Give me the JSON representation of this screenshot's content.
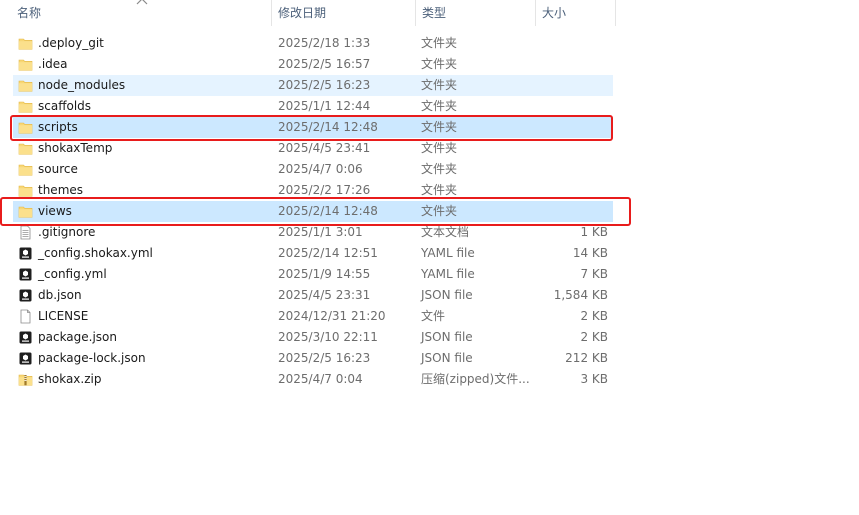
{
  "columns": {
    "name": "名称",
    "date": "修改日期",
    "type": "类型",
    "size": "大小"
  },
  "colors": {
    "selected_bg": "#cce8ff",
    "hover_bg": "#e5f3ff",
    "highlight_border": "#e81c1c",
    "header_text": "#4c607a"
  },
  "files": [
    {
      "name": ".deploy_git",
      "date": "2025/2/18 1:33",
      "type": "文件夹",
      "size": "",
      "icon": "folder-icon",
      "state": ""
    },
    {
      "name": ".idea",
      "date": "2025/2/5 16:57",
      "type": "文件夹",
      "size": "",
      "icon": "folder-icon",
      "state": ""
    },
    {
      "name": "node_modules",
      "date": "2025/2/5 16:23",
      "type": "文件夹",
      "size": "",
      "icon": "folder-icon",
      "state": "hover"
    },
    {
      "name": "scaffolds",
      "date": "2025/1/1 12:44",
      "type": "文件夹",
      "size": "",
      "icon": "folder-icon",
      "state": ""
    },
    {
      "name": "scripts",
      "date": "2025/2/14 12:48",
      "type": "文件夹",
      "size": "",
      "icon": "folder-icon",
      "state": "selected"
    },
    {
      "name": "shokaxTemp",
      "date": "2025/4/5 23:41",
      "type": "文件夹",
      "size": "",
      "icon": "folder-icon",
      "state": ""
    },
    {
      "name": "source",
      "date": "2025/4/7 0:06",
      "type": "文件夹",
      "size": "",
      "icon": "folder-icon",
      "state": ""
    },
    {
      "name": "themes",
      "date": "2025/2/2 17:26",
      "type": "文件夹",
      "size": "",
      "icon": "folder-icon",
      "state": ""
    },
    {
      "name": "views",
      "date": "2025/2/14 12:48",
      "type": "文件夹",
      "size": "",
      "icon": "folder-icon",
      "state": "selected"
    },
    {
      "name": ".gitignore",
      "date": "2025/1/1 3:01",
      "type": "文本文档",
      "size": "1 KB",
      "icon": "text-file-icon",
      "state": ""
    },
    {
      "name": "_config.shokax.yml",
      "date": "2025/2/14 12:51",
      "type": "YAML file",
      "size": "14 KB",
      "icon": "app-file-icon",
      "state": ""
    },
    {
      "name": "_config.yml",
      "date": "2025/1/9 14:55",
      "type": "YAML file",
      "size": "7 KB",
      "icon": "app-file-icon",
      "state": ""
    },
    {
      "name": "db.json",
      "date": "2025/4/5 23:31",
      "type": "JSON file",
      "size": "1,584 KB",
      "icon": "app-file-icon",
      "state": ""
    },
    {
      "name": "LICENSE",
      "date": "2024/12/31 21:20",
      "type": "文件",
      "size": "2 KB",
      "icon": "blank-file-icon",
      "state": ""
    },
    {
      "name": "package.json",
      "date": "2025/3/10 22:11",
      "type": "JSON file",
      "size": "2 KB",
      "icon": "app-file-icon",
      "state": ""
    },
    {
      "name": "package-lock.json",
      "date": "2025/2/5 16:23",
      "type": "JSON file",
      "size": "212 KB",
      "icon": "app-file-icon",
      "state": ""
    },
    {
      "name": "shokax.zip",
      "date": "2025/4/7 0:04",
      "type": "压缩(zipped)文件...",
      "size": "3 KB",
      "icon": "zip-folder-icon",
      "state": ""
    }
  ]
}
